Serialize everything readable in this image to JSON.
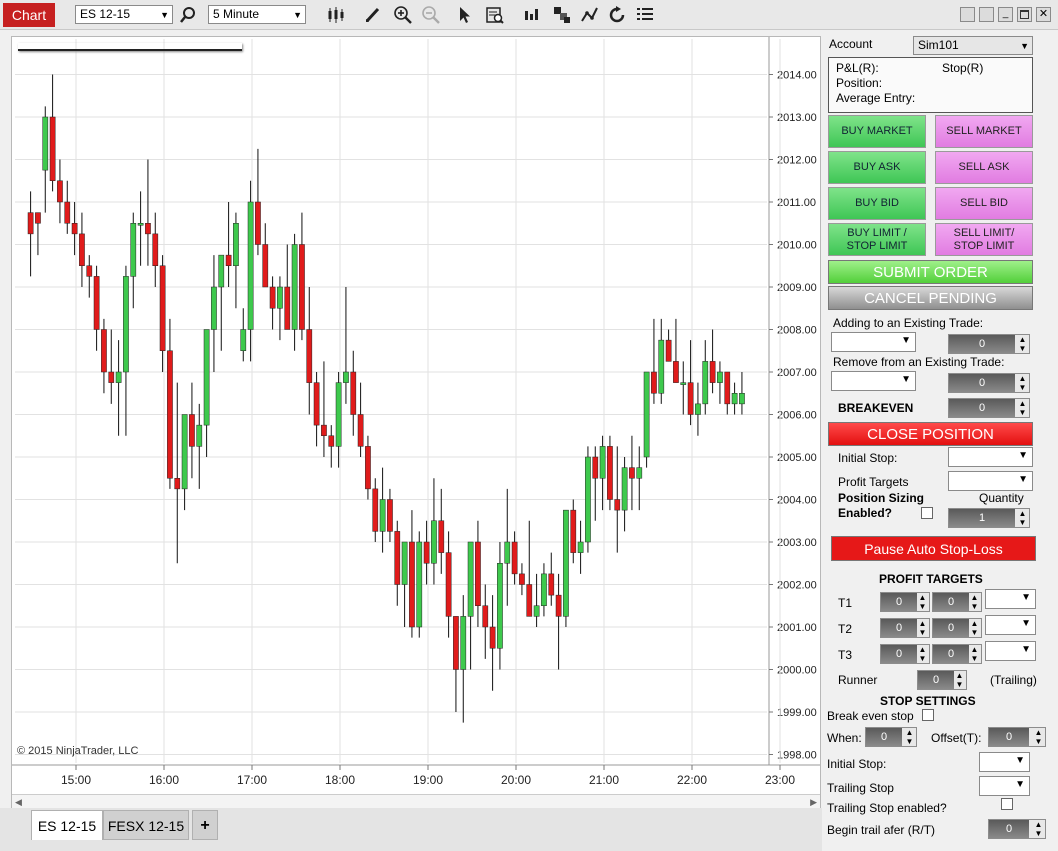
{
  "toolbar": {
    "chart_tab": "Chart",
    "instrument": "ES 12-15",
    "interval": "5 Minute"
  },
  "chart": {
    "copyright": "© 2015 NinjaTrader, LLC",
    "colors": {
      "up": "#3ec94d",
      "down": "#e01b1b",
      "grid": "#e2e2e2",
      "wick": "#111111"
    },
    "tabs": [
      "ES 12-15",
      "FESX 12-15",
      "+"
    ]
  },
  "chart_data": {
    "type": "candlestick",
    "y_ticks": [
      "2014.00",
      "2013.00",
      "2012.00",
      "2011.00",
      "2010.00",
      "2009.00",
      "2008.00",
      "2007.00",
      "2006.00",
      "2005.00",
      "2004.00",
      "2003.00",
      "2002.00",
      "2001.00",
      "2000.00",
      "1999.00",
      "1998.00"
    ],
    "x_ticks": [
      "15:00",
      "16:00",
      "17:00",
      "18:00",
      "19:00",
      "20:00",
      "21:00",
      "22:00",
      "23:00"
    ],
    "ylim": [
      1997.75,
      2014.75
    ],
    "candles": [
      [
        2010.75,
        2011.25,
        2009.25,
        2010.25
      ],
      [
        2010.75,
        2010.75,
        2009.75,
        2010.5
      ],
      [
        2011.75,
        2013.25,
        2010.75,
        2013.0
      ],
      [
        2013.0,
        2014.0,
        2011.25,
        2011.5
      ],
      [
        2011.5,
        2012.0,
        2010.5,
        2011.0
      ],
      [
        2011.0,
        2011.5,
        2010.25,
        2010.5
      ],
      [
        2010.5,
        2011.0,
        2009.75,
        2010.25
      ],
      [
        2010.25,
        2010.75,
        2009.0,
        2009.5
      ],
      [
        2009.5,
        2009.75,
        2008.75,
        2009.25
      ],
      [
        2009.25,
        2009.5,
        2007.5,
        2008.0
      ],
      [
        2008.0,
        2008.25,
        2006.5,
        2007.0
      ],
      [
        2007.0,
        2008.0,
        2006.25,
        2006.75
      ],
      [
        2006.75,
        2007.75,
        2005.5,
        2007.0
      ],
      [
        2007.0,
        2009.5,
        2005.5,
        2009.25
      ],
      [
        2009.25,
        2010.75,
        2008.5,
        2010.5
      ],
      [
        2010.5,
        2011.25,
        2009.5,
        2010.5
      ],
      [
        2010.5,
        2012.0,
        2009.5,
        2010.25
      ],
      [
        2010.25,
        2010.75,
        2009.0,
        2009.5
      ],
      [
        2009.5,
        2009.75,
        2007.0,
        2007.5
      ],
      [
        2007.5,
        2008.25,
        2004.25,
        2004.5
      ],
      [
        2004.5,
        2006.75,
        2002.5,
        2004.25
      ],
      [
        2004.25,
        2005.75,
        2003.75,
        2006.0
      ],
      [
        2006.0,
        2006.75,
        2004.5,
        2005.25
      ],
      [
        2005.25,
        2006.25,
        2004.25,
        2005.75
      ],
      [
        2005.75,
        2008.0,
        2005.0,
        2008.0
      ],
      [
        2008.0,
        2009.75,
        2007.0,
        2009.0
      ],
      [
        2009.0,
        2009.25,
        2007.5,
        2009.75
      ],
      [
        2009.75,
        2011.0,
        2009.0,
        2009.5
      ],
      [
        2009.5,
        2010.75,
        2008.5,
        2010.5
      ],
      [
        2007.5,
        2008.5,
        2007.25,
        2008.0
      ],
      [
        2008.0,
        2011.5,
        2007.25,
        2011.0
      ],
      [
        2011.0,
        2012.25,
        2009.75,
        2010.0
      ],
      [
        2010.0,
        2010.5,
        2009.0,
        2009.0
      ],
      [
        2009.0,
        2009.25,
        2008.0,
        2008.5
      ],
      [
        2008.5,
        2009.25,
        2007.75,
        2009.0
      ],
      [
        2009.0,
        2010.0,
        2008.0,
        2008.0
      ],
      [
        2008.0,
        2010.25,
        2007.5,
        2010.0
      ],
      [
        2010.0,
        2010.75,
        2007.75,
        2008.0
      ],
      [
        2008.0,
        2009.0,
        2006.0,
        2006.75
      ],
      [
        2006.75,
        2007.0,
        2005.25,
        2005.75
      ],
      [
        2005.75,
        2007.25,
        2005.0,
        2005.5
      ],
      [
        2005.5,
        2005.75,
        2004.75,
        2005.25
      ],
      [
        2005.25,
        2007.0,
        2004.75,
        2006.75
      ],
      [
        2006.75,
        2009.0,
        2006.25,
        2007.0
      ],
      [
        2007.0,
        2007.5,
        2005.5,
        2006.0
      ],
      [
        2006.0,
        2006.75,
        2005.0,
        2005.25
      ],
      [
        2005.25,
        2005.5,
        2004.0,
        2004.25
      ],
      [
        2004.25,
        2004.5,
        2003.0,
        2003.25
      ],
      [
        2003.25,
        2004.75,
        2002.75,
        2004.0
      ],
      [
        2004.0,
        2004.25,
        2003.0,
        2003.25
      ],
      [
        2003.25,
        2003.5,
        2001.5,
        2002.0
      ],
      [
        2002.0,
        2003.0,
        2001.0,
        2003.0
      ],
      [
        2003.0,
        2003.75,
        2000.75,
        2001.0
      ],
      [
        2001.0,
        2003.25,
        2000.75,
        2003.0
      ],
      [
        2003.0,
        2003.5,
        2002.0,
        2002.5
      ],
      [
        2002.5,
        2004.5,
        2002.0,
        2003.5
      ],
      [
        2003.5,
        2004.25,
        2002.25,
        2002.75
      ],
      [
        2002.75,
        2003.25,
        2000.75,
        2001.25
      ],
      [
        2001.25,
        2001.25,
        1999.0,
        2000.0
      ],
      [
        2000.0,
        2001.75,
        1998.75,
        2001.25
      ],
      [
        2001.25,
        2003.0,
        2000.0,
        2003.0
      ],
      [
        2003.0,
        2003.5,
        2001.0,
        2001.5
      ],
      [
        2001.5,
        2002.0,
        2000.25,
        2001.0
      ],
      [
        2001.0,
        2001.75,
        1999.5,
        2000.5
      ],
      [
        2000.5,
        2003.0,
        2000.0,
        2002.5
      ],
      [
        2002.5,
        2004.25,
        2001.5,
        2003.0
      ],
      [
        2003.0,
        2003.25,
        2002.0,
        2002.25
      ],
      [
        2002.25,
        2002.5,
        2001.75,
        2002.0
      ],
      [
        2002.0,
        2003.5,
        2001.25,
        2001.25
      ],
      [
        2001.25,
        2002.25,
        2001.0,
        2001.5
      ],
      [
        2001.5,
        2002.5,
        2001.25,
        2002.25
      ],
      [
        2002.25,
        2002.75,
        2001.5,
        2001.75
      ],
      [
        2001.75,
        2002.25,
        2000.0,
        2001.25
      ],
      [
        2001.25,
        2003.75,
        2001.0,
        2003.75
      ],
      [
        2003.75,
        2004.0,
        2002.5,
        2002.75
      ],
      [
        2002.75,
        2003.5,
        2002.25,
        2003.0
      ],
      [
        2003.0,
        2005.25,
        2002.75,
        2005.0
      ],
      [
        2005.0,
        2005.25,
        2003.5,
        2004.5
      ],
      [
        2004.5,
        2005.5,
        2003.75,
        2005.25
      ],
      [
        2005.25,
        2005.5,
        2003.75,
        2004.0
      ],
      [
        2004.0,
        2005.25,
        2002.75,
        2003.75
      ],
      [
        2003.75,
        2005.0,
        2003.25,
        2004.75
      ],
      [
        2004.75,
        2005.5,
        2003.75,
        2004.5
      ],
      [
        2004.5,
        2005.25,
        2003.75,
        2004.75
      ],
      [
        2005.0,
        2007.0,
        2004.75,
        2007.0
      ],
      [
        2007.0,
        2008.25,
        2006.25,
        2006.5
      ],
      [
        2006.5,
        2008.25,
        2006.25,
        2007.75
      ],
      [
        2007.75,
        2008.0,
        2007.25,
        2007.25
      ],
      [
        2007.25,
        2008.25,
        2006.75,
        2006.75
      ],
      [
        2006.75,
        2007.25,
        2006.0,
        2006.75
      ],
      [
        2006.75,
        2007.75,
        2005.75,
        2006.0
      ],
      [
        2006.0,
        2006.75,
        2005.5,
        2006.25
      ],
      [
        2006.25,
        2007.75,
        2006.0,
        2007.25
      ],
      [
        2007.25,
        2008.0,
        2006.5,
        2006.75
      ],
      [
        2006.75,
        2007.25,
        2006.25,
        2007.0
      ],
      [
        2007.0,
        2007.0,
        2006.0,
        2006.25
      ],
      [
        2006.25,
        2006.75,
        2006.0,
        2006.5
      ],
      [
        2006.25,
        2007.0,
        2006.0,
        2006.5
      ]
    ]
  },
  "panel": {
    "account_label": "Account",
    "account_value": "Sim101",
    "pnl_label": "P&L(R):",
    "stop_label": "Stop(R)",
    "position_label": "Position:",
    "avg_entry_label": "Average Entry:",
    "buy_market": "BUY MARKET",
    "sell_market": "SELL MARKET",
    "buy_ask": "BUY ASK",
    "sell_ask": "SELL ASK",
    "buy_bid": "BUY BID",
    "sell_bid": "SELL BID",
    "buy_limit_1": "BUY LIMIT /",
    "buy_limit_2": "STOP LIMIT",
    "sell_limit_1": "SELL LIMIT/",
    "sell_limit_2": "STOP LIMIT",
    "submit_order": "SUBMIT ORDER",
    "cancel_pending": "CANCEL PENDING",
    "adding_label": "Adding to an Existing Trade:",
    "adding_qty": "0",
    "remove_label": "Remove from an Existing Trade:",
    "remove_qty": "0",
    "breakeven_label": "BREAKEVEN",
    "breakeven_qty": "0",
    "close_position": "CLOSE POSITION",
    "initial_stop_label": "Initial Stop:",
    "profit_targets_label": "Profit Targets",
    "position_sizing_label_1": "Position Sizing",
    "position_sizing_label_2": "Enabled?",
    "quantity_label": "Quantity",
    "quantity_value": "1",
    "pause_stop_loss": "Pause Auto Stop-Loss",
    "profit_targets_header": "PROFIT TARGETS",
    "t1": "T1",
    "t2": "T2",
    "t3": "T3",
    "target_zero": "0",
    "runner_label": "Runner",
    "runner_value": "0",
    "trailing_label": "(Trailing)",
    "stop_settings_header": "STOP SETTINGS",
    "break_even_stop_label": "Break even stop",
    "when_label": "When:",
    "when_value": "0",
    "offset_label": "Offset(T):",
    "offset_value": "0",
    "initial_stop2_label": "Initial Stop:",
    "trailing_stop_label": "Trailing Stop",
    "trailing_enabled_label": "Trailing Stop enabled?",
    "begin_trail_label": "Begin trail afer (R/T)",
    "begin_trail_value": "0"
  }
}
